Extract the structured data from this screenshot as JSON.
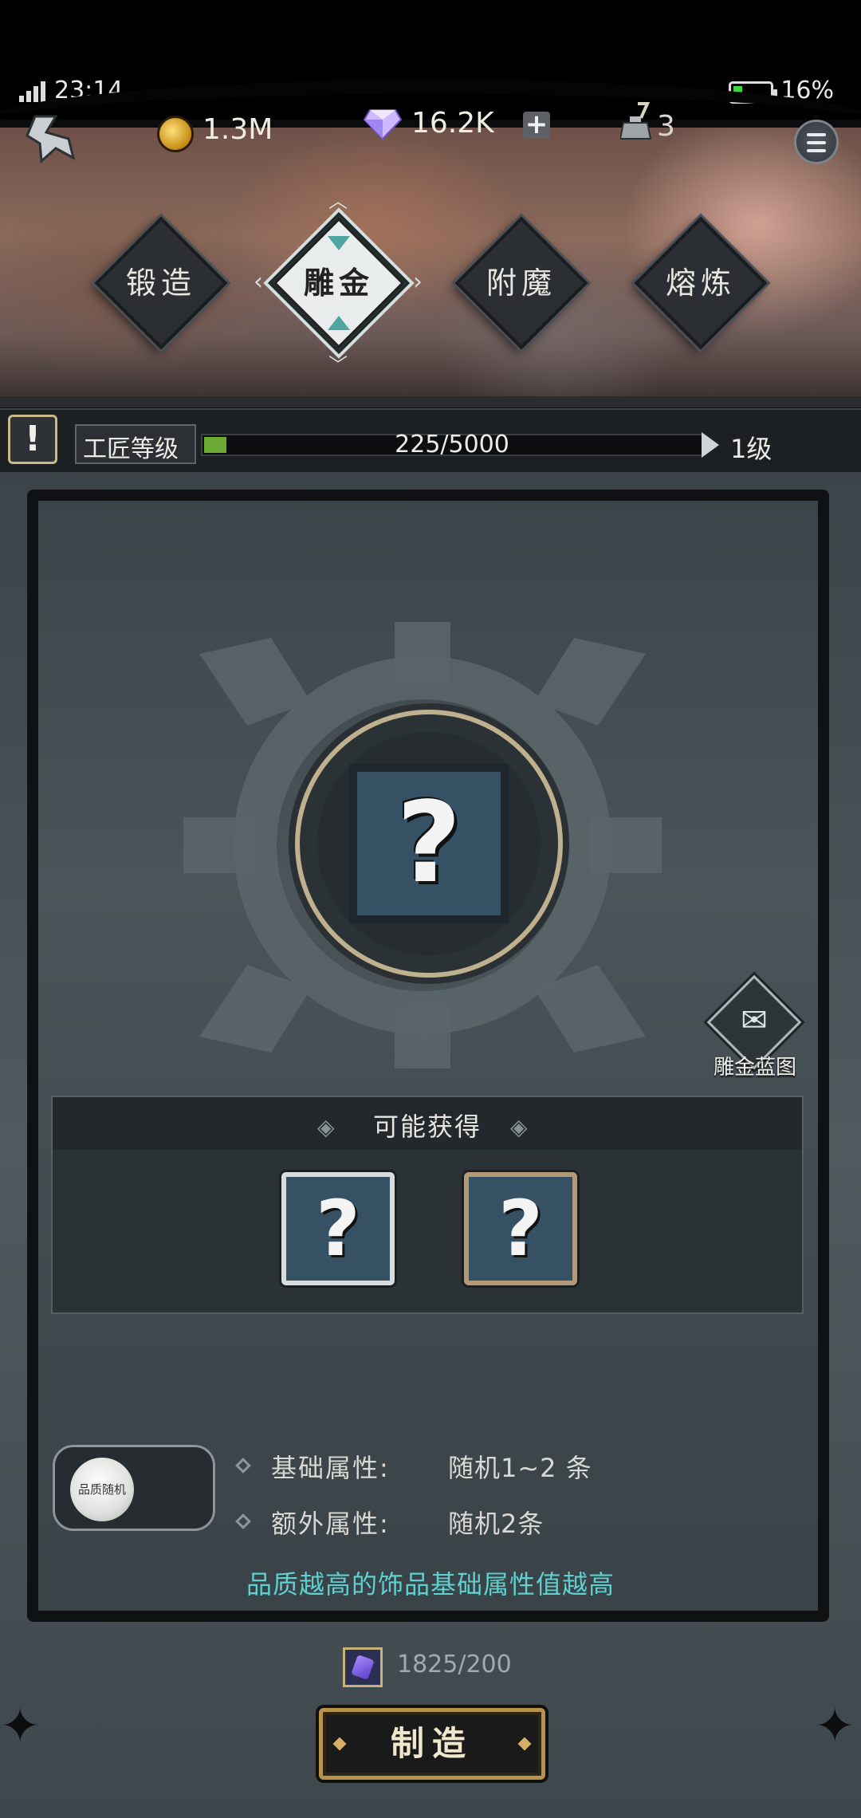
{
  "status_bar": {
    "time": "23:14",
    "battery": "16%"
  },
  "resources": {
    "coins": "1.3M",
    "gems": "16.2K",
    "add_label": "+",
    "ink": "3"
  },
  "tabs": [
    {
      "label": "锻造",
      "active": false
    },
    {
      "label": "雕金",
      "active": true
    },
    {
      "label": "附魔",
      "active": false
    },
    {
      "label": "熔炼",
      "active": false
    }
  ],
  "craftsman": {
    "warn": "!",
    "label": "工匠等级",
    "progress": "225/5000",
    "progress_fraction": 0.045,
    "level": "1级"
  },
  "blueprint": {
    "label": "雕金蓝图"
  },
  "obtain": {
    "title": "可能获得",
    "items": [
      "?",
      "?"
    ]
  },
  "main_slot": "?",
  "quality_orb_text": "品质随机",
  "attributes": [
    {
      "key": "基础属性:",
      "value": "随机1~2 条"
    },
    {
      "key": "额外属性:",
      "value": "随机2条"
    }
  ],
  "tip": "品质越高的饰品基础属性值越高",
  "material": {
    "count": "1825/200"
  },
  "craft_button": "制造"
}
